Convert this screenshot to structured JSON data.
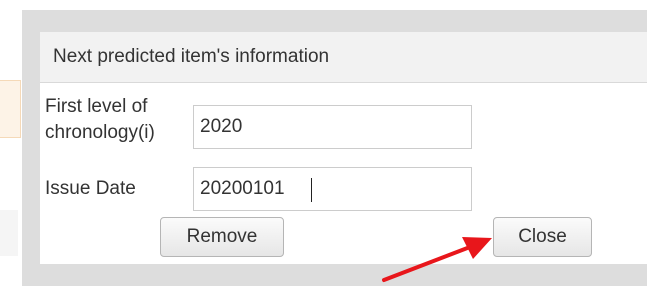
{
  "dialog": {
    "title": "Next predicted item's information",
    "fields": [
      {
        "label_line1": "First level of",
        "label_line2": "chronology(i)",
        "value": "2020"
      },
      {
        "label": "Issue Date",
        "value": "20200101"
      }
    ],
    "buttons": {
      "remove_label": "Remove",
      "close_label": "Close"
    }
  },
  "annotation": {
    "arrow_color": "#e8161b",
    "target": "close-button"
  }
}
